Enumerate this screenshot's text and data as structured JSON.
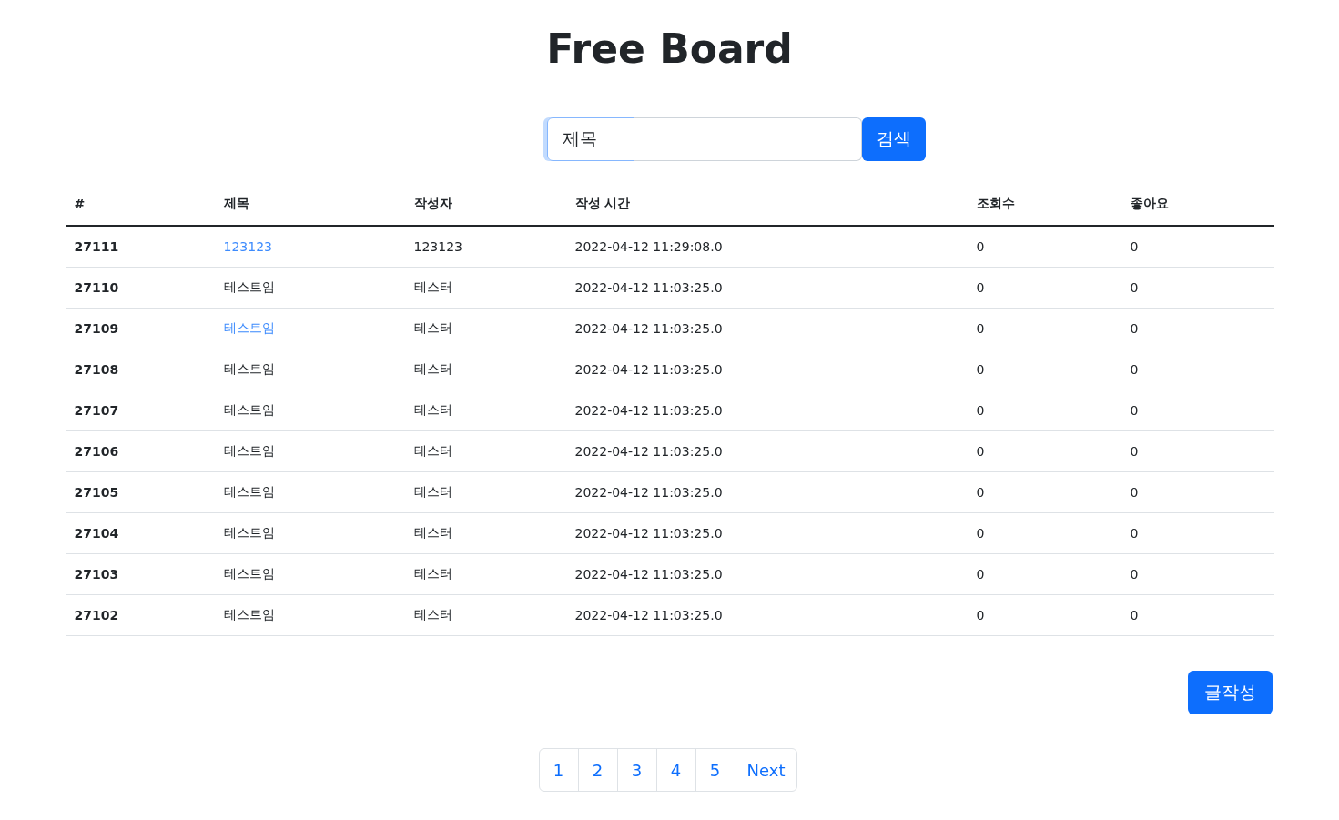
{
  "title": "Free Board",
  "search": {
    "field": "제목",
    "button": "검색"
  },
  "table": {
    "columns": [
      "#",
      "제목",
      "작성자",
      "작성 시간",
      "조회수",
      "좋아요"
    ],
    "rows": [
      {
        "id": "27111",
        "title": "123123",
        "title_highlighted": true,
        "author": "123123",
        "time": "2022-04-12 11:29:08.0",
        "views": "0",
        "likes": "0"
      },
      {
        "id": "27110",
        "title": "테스트임",
        "title_highlighted": false,
        "author": "테스터",
        "time": "2022-04-12 11:03:25.0",
        "views": "0",
        "likes": "0"
      },
      {
        "id": "27109",
        "title": "테스트임",
        "title_highlighted": true,
        "author": "테스터",
        "time": "2022-04-12 11:03:25.0",
        "views": "0",
        "likes": "0"
      },
      {
        "id": "27108",
        "title": "테스트임",
        "title_highlighted": false,
        "author": "테스터",
        "time": "2022-04-12 11:03:25.0",
        "views": "0",
        "likes": "0"
      },
      {
        "id": "27107",
        "title": "테스트임",
        "title_highlighted": false,
        "author": "테스터",
        "time": "2022-04-12 11:03:25.0",
        "views": "0",
        "likes": "0"
      },
      {
        "id": "27106",
        "title": "테스트임",
        "title_highlighted": false,
        "author": "테스터",
        "time": "2022-04-12 11:03:25.0",
        "views": "0",
        "likes": "0"
      },
      {
        "id": "27105",
        "title": "테스트임",
        "title_highlighted": false,
        "author": "테스터",
        "time": "2022-04-12 11:03:25.0",
        "views": "0",
        "likes": "0"
      },
      {
        "id": "27104",
        "title": "테스트임",
        "title_highlighted": false,
        "author": "테스터",
        "time": "2022-04-12 11:03:25.0",
        "views": "0",
        "likes": "0"
      },
      {
        "id": "27103",
        "title": "테스트임",
        "title_highlighted": false,
        "author": "테스터",
        "time": "2022-04-12 11:03:25.0",
        "views": "0",
        "likes": "0"
      },
      {
        "id": "27102",
        "title": "테스트임",
        "title_highlighted": false,
        "author": "테스터",
        "time": "2022-04-12 11:03:25.0",
        "views": "0",
        "likes": "0"
      }
    ]
  },
  "write_button": "글작성",
  "pagination": [
    "1",
    "2",
    "3",
    "4",
    "5",
    "Next"
  ]
}
